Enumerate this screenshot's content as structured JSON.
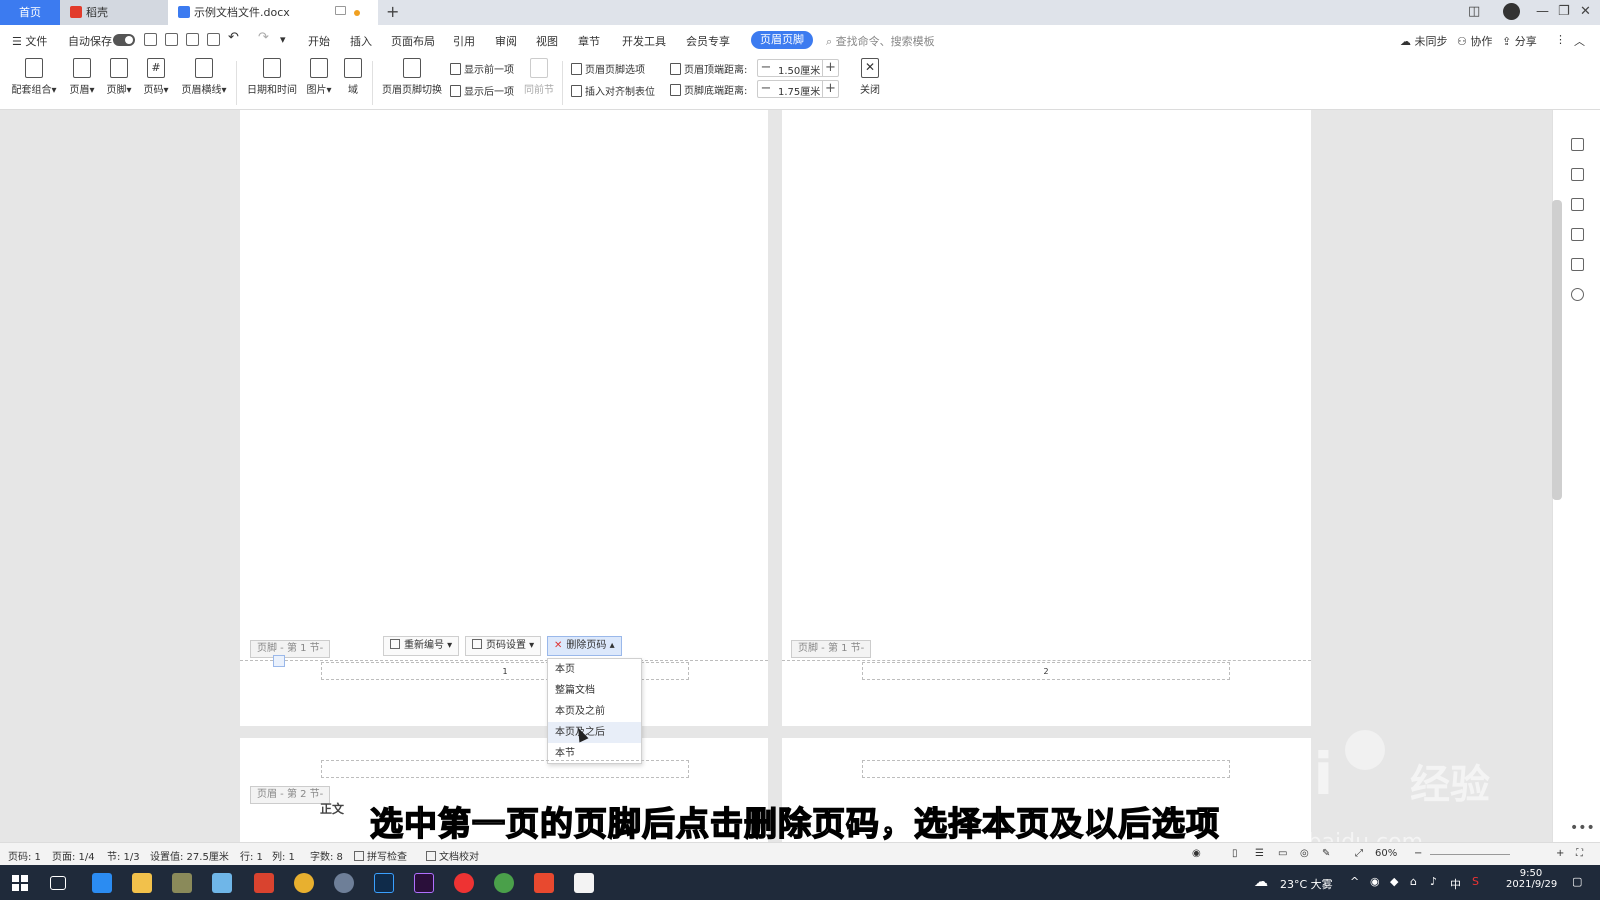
{
  "tabs": {
    "home": "首页",
    "daoke": "稻壳",
    "document": "示例文档文件.docx"
  },
  "menu": {
    "file": "文件",
    "autosave": "自动保存",
    "items": [
      "开始",
      "插入",
      "页面布局",
      "引用",
      "审阅",
      "视图",
      "章节",
      "开发工具",
      "会员专享"
    ],
    "active": "页眉页脚",
    "search_placeholder": "查找命令、搜索模板",
    "sync": "未同步",
    "collab": "协作",
    "share": "分享"
  },
  "ribbon": {
    "combo": "配套组合",
    "header": "页眉",
    "footer": "页脚",
    "page_number": "页码",
    "header_line": "页眉横线",
    "datetime": "日期和时间",
    "picture": "图片",
    "field": "域",
    "switch": "页眉页脚切换",
    "show_prev": "显示前一项",
    "show_next": "显示后一项",
    "same_as_prev": "同前节",
    "options": "页眉页脚选项",
    "insert_tab": "插入对齐制表位",
    "header_top_label": "页眉顶端距离:",
    "header_top_value": "1.50厘米",
    "footer_bottom_label": "页脚底端距离:",
    "footer_bottom_value": "1.75厘米",
    "close": "关闭"
  },
  "document": {
    "footer_tag_1": "页脚 - 第 1 节-",
    "footer_tag_2": "页脚 - 第 1 节-",
    "header_tag_3": "页眉 - 第 2 节-",
    "page_num_1": "1",
    "page_num_2": "2",
    "body_text": "正文"
  },
  "footer_toolbar": {
    "renumber": "重新编号",
    "settings": "页码设置",
    "delete": "删除页码"
  },
  "dropdown": {
    "items": [
      "本页",
      "整篇文档",
      "本页及之前",
      "本页及之后",
      "本节"
    ]
  },
  "status": {
    "page_num": "页码: 1",
    "page": "页面: 1/4",
    "section": "节: 1/3",
    "setting": "设置值: 27.5厘米",
    "row": "行: 1",
    "col": "列: 1",
    "words": "字数: 8",
    "spell": "拼写检查",
    "proof": "文档校对",
    "zoom": "60%"
  },
  "subtitle": "选中第一页的页脚后点击删除页码，选择本页及以后选项",
  "watermark": {
    "brand": "Bai",
    "brand_cn": "经验",
    "url": "jingyan.baidu.com"
  },
  "taskbar": {
    "weather": "23°C 大雾",
    "ime": "中",
    "time": "9:50",
    "date": "2021/9/29"
  },
  "colors": {
    "accent": "#3c7bf0",
    "taskbar": "#1f2a3a"
  }
}
